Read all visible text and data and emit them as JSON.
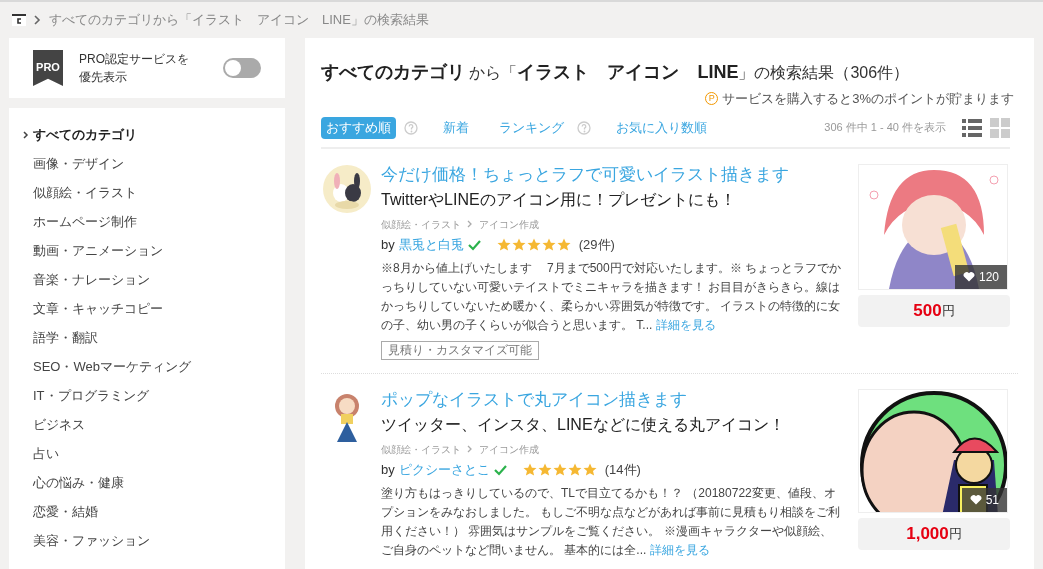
{
  "breadcrumb": {
    "text": "すべてのカテゴリから「イラスト　アイコン　LINE」の検索結果"
  },
  "pro_filter": {
    "badge": "PRO",
    "label": "PRO認定サービスを優先表示",
    "on": false
  },
  "categories": [
    {
      "label": "すべてのカテゴリ",
      "selected": true
    },
    {
      "label": "画像・デザイン",
      "selected": false
    },
    {
      "label": "似顔絵・イラスト",
      "selected": false
    },
    {
      "label": "ホームページ制作",
      "selected": false
    },
    {
      "label": "動画・アニメーション",
      "selected": false
    },
    {
      "label": "音楽・ナレーション",
      "selected": false
    },
    {
      "label": "文章・キャッチコピー",
      "selected": false
    },
    {
      "label": "語学・翻訳",
      "selected": false
    },
    {
      "label": "SEO・Webマーケティング",
      "selected": false
    },
    {
      "label": "IT・プログラミング",
      "selected": false
    },
    {
      "label": "ビジネス",
      "selected": false
    },
    {
      "label": "占い",
      "selected": false
    },
    {
      "label": "心の悩み・健康",
      "selected": false
    },
    {
      "label": "恋愛・結婚",
      "selected": false
    },
    {
      "label": "美容・ファッション",
      "selected": false
    }
  ],
  "heading": "**すべてのカテゴリ** から「**イラスト　アイコン　LINE**」の検索結果（306件）",
  "points_badge": "P",
  "points_note": "サービスを購入すると3%のポイントが貯まります",
  "sort_tabs": [
    {
      "label": "おすすめ順",
      "selected": true,
      "help": true
    },
    {
      "label": "新着",
      "selected": false,
      "help": false
    },
    {
      "label": "ランキング",
      "selected": false,
      "help": true
    },
    {
      "label": "お気に入り数順",
      "selected": false,
      "help": false
    }
  ],
  "result_count": "306 件中 1 - 40 件を表示",
  "view_modes": [
    {
      "kind": "list",
      "selected": true
    },
    {
      "kind": "grid",
      "selected": false
    }
  ],
  "services": [
    {
      "title": "今だけ価格！ちょっとラフで可愛いイラスト描きます",
      "subtitle": "TwitterやLINEのアイコン用に！プレゼントにも！",
      "category": "似顔絵・イラスト",
      "subcategory": "アイコン作成",
      "by": "by",
      "seller": "黒兎と白兎",
      "verified": true,
      "stars": 5,
      "reviews": "(29件)",
      "description": "※8月から値上げいたします　 7月まで500円で対応いたします。※ ちょっとラフでかっちりしていない可愛いテイストでミニキャラを描きます！ お目目がきらきら。線はかっちりしていないため暖かく、柔らかい雰囲気が特徴です。 イラストの特徴的に女の子、幼い男の子くらいが似合うと思います。 T...",
      "more": "詳細を見る",
      "tag": "見積り・カスタマイズ可能",
      "likes": "120",
      "price": "500",
      "currency": "円"
    },
    {
      "title": "ポップなイラストで丸アイコン描きます",
      "subtitle": "ツイッター、インスタ、LINEなどに使える丸アイコン！",
      "category": "似顔絵・イラスト",
      "subcategory": "アイコン作成",
      "by": "by",
      "seller": "ピクシーさとこ",
      "verified": true,
      "stars": 5,
      "reviews": "(14件)",
      "description": "塗り方もはっきりしているので、TLで目立てるかも！？ （20180722変更、値段、オプションをみなおしました。 もしご不明な点などがあれば事前に見積もり相談をご利用ください！） 雰囲気はサンプルをご覧ください。 ※漫画キャラクターや似顔絵、ご自身のペットなど問いません。 基本的には全...",
      "more": "詳細を見る",
      "likes": "51",
      "price": "1,000",
      "currency": "円"
    }
  ]
}
